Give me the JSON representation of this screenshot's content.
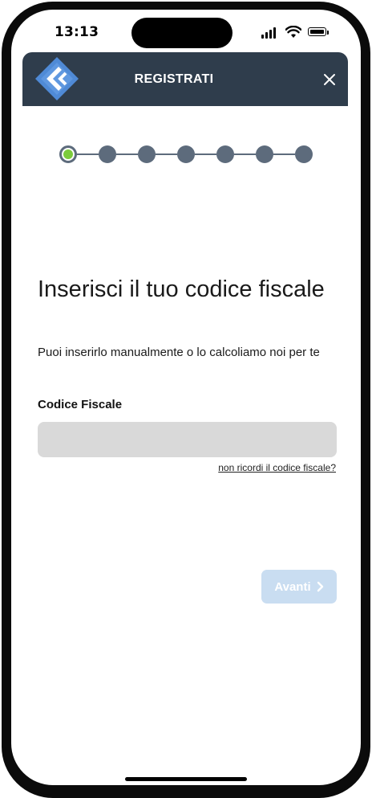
{
  "status_bar": {
    "time": "13:13"
  },
  "header": {
    "title": "REGISTRATI",
    "logo_icon": "app-logo-icon",
    "close_icon": "close-icon",
    "background_color": "#2f3d4c"
  },
  "stepper": {
    "total_steps": 7,
    "current_step": 1,
    "active_color": "#7ccb3b",
    "inactive_color": "#5d6b7c"
  },
  "main": {
    "headline": "Inserisci il tuo codice fiscale",
    "subtitle": "Puoi inserirlo manualmente o lo calcoliamo noi per te",
    "field_label": "Codice Fiscale",
    "field_value": "",
    "forgot_link": "non ricordi il codice fiscale?"
  },
  "actions": {
    "next_label": "Avanti",
    "next_icon": "chevron-right-icon",
    "next_color": "#c9ddf1"
  }
}
